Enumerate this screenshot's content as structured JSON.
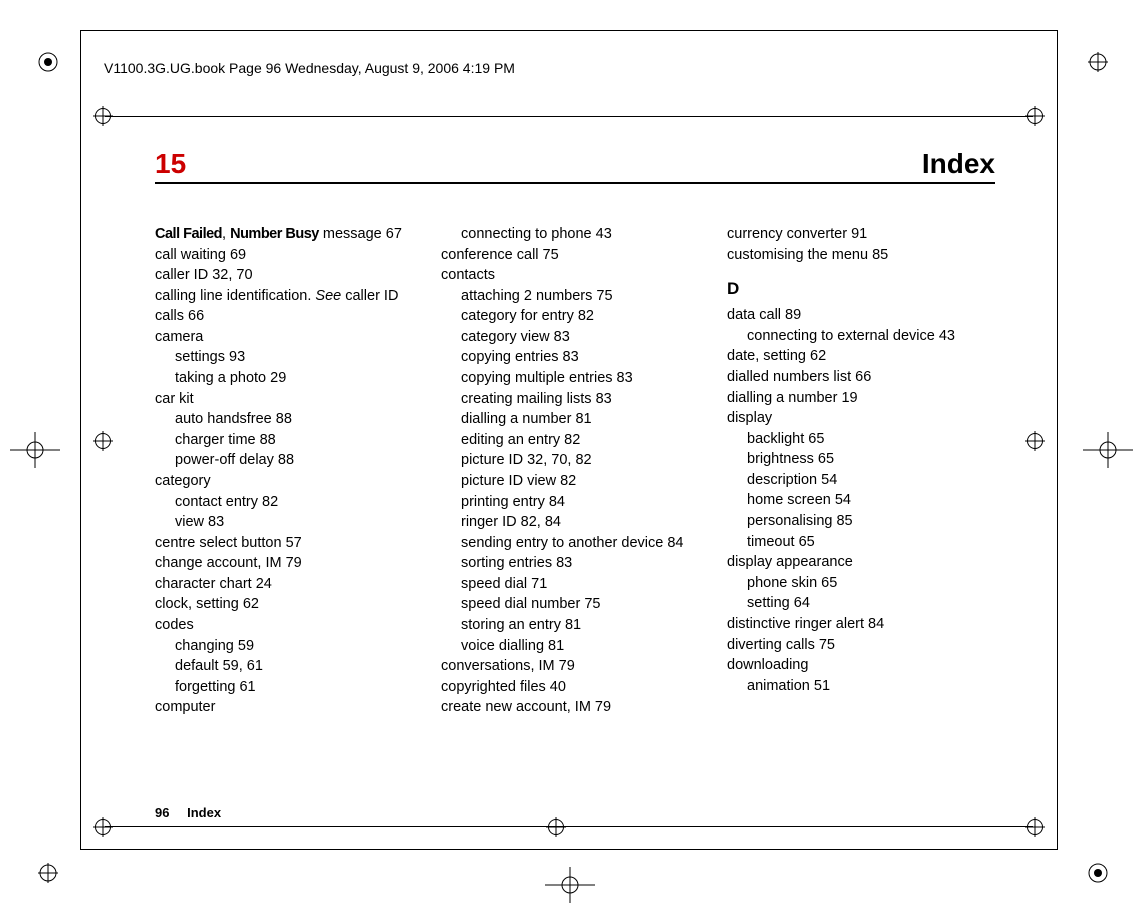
{
  "header": "V1100.3G.UG.book  Page 96  Wednesday, August 9, 2006  4:19 PM",
  "chapter_num": "15",
  "chapter_title": "Index",
  "footer_page": "96",
  "footer_label": "Index",
  "col1": {
    "l1a": "Call Failed",
    "l1b": ", ",
    "l1c": "Number Busy",
    "l1d": " message  67",
    "l2": "call waiting  69",
    "l3": "caller ID  32, 70",
    "l4a": "calling line identification. ",
    "l4b": "See",
    "l4c": " caller ID",
    "l5": "calls  66",
    "l6": "camera",
    "l7": "settings  93",
    "l8": "taking a photo  29",
    "l9": "car kit",
    "l10": "auto handsfree  88",
    "l11": "charger time  88",
    "l12": "power-off delay  88",
    "l13": "category",
    "l14": "contact entry  82",
    "l15": "view  83",
    "l16": "centre select button  57",
    "l17": "change account, IM  79",
    "l18": "character chart  24",
    "l19": "clock, setting  62",
    "l20": "codes",
    "l21": "changing  59",
    "l22": "default  59, 61",
    "l23": "forgetting  61",
    "l24": "computer"
  },
  "col2": {
    "l1": "connecting to phone  43",
    "l2": "conference call  75",
    "l3": "contacts",
    "l4": "attaching 2 numbers  75",
    "l5": "category for entry  82",
    "l6": "category view  83",
    "l7": "copying entries  83",
    "l8": "copying multiple entries  83",
    "l9": "creating mailing lists  83",
    "l10": "dialling a number  81",
    "l11": "editing an entry  82",
    "l12": "picture ID  32, 70, 82",
    "l13": "picture ID view  82",
    "l14": "printing entry  84",
    "l15": "ringer ID  82, 84",
    "l16": "sending entry to another device  84",
    "l17": "sorting entries  83",
    "l18": "speed dial  71",
    "l19": "speed dial number  75",
    "l20": "storing an entry  81",
    "l21": "voice dialling  81",
    "l22": "conversations, IM  79",
    "l23": "copyrighted files  40",
    "l24": "create new account, IM  79"
  },
  "col3": {
    "l1": "currency converter  91",
    "l2": "customising the menu  85",
    "d_head": "D",
    "l3": "data call  89",
    "l4": "connecting to external device  43",
    "l5": "date, setting  62",
    "l6": "dialled numbers list  66",
    "l7": "dialling a number  19",
    "l8": "display",
    "l9": "backlight  65",
    "l10": "brightness  65",
    "l11": "description  54",
    "l12": "home screen  54",
    "l13": "personalising  85",
    "l14": "timeout  65",
    "l15": "display appearance",
    "l16": "phone skin  65",
    "l17": "setting  64",
    "l18": "distinctive ringer alert  84",
    "l19": "diverting calls  75",
    "l20": "downloading",
    "l21": "animation  51"
  }
}
